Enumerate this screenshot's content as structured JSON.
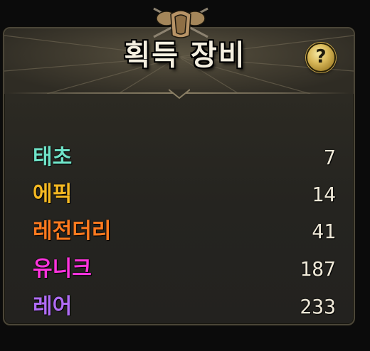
{
  "panel": {
    "title": "획득 장비",
    "help_label": "?"
  },
  "colors": {
    "title": "#f4efe0",
    "count": "#efe9d8",
    "help_gold": "#d9b95a"
  },
  "icons": {
    "emblem": "armor-crest-icon",
    "help": "question-mark-icon"
  },
  "grades": [
    {
      "name": "태초",
      "count": "7",
      "color": "#6fe3c8"
    },
    {
      "name": "에픽",
      "count": "14",
      "color": "#f5b922"
    },
    {
      "name": "레전더리",
      "count": "41",
      "color": "#ff7a1f"
    },
    {
      "name": "유니크",
      "count": "187",
      "color": "#ff33dd"
    },
    {
      "name": "레어",
      "count": "233",
      "color": "#b06cf5"
    }
  ]
}
